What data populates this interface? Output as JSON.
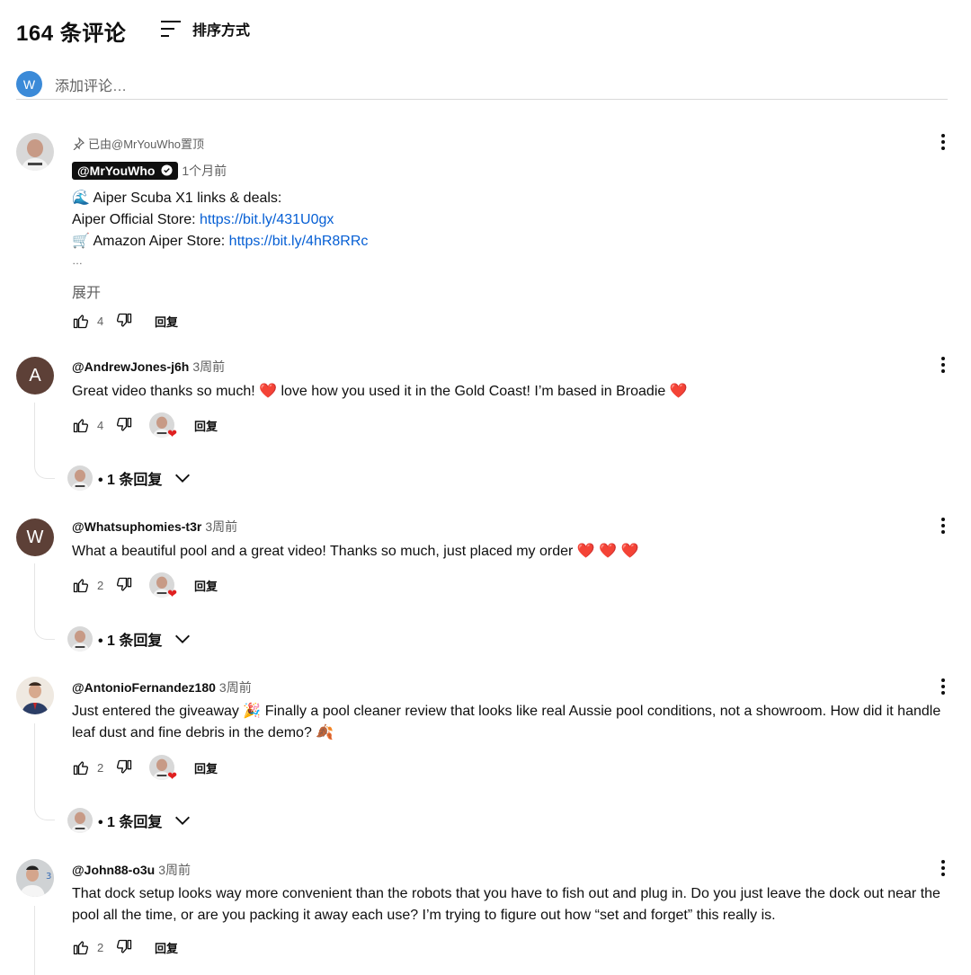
{
  "header": {
    "count_title": "164 条评论",
    "sort_label": "排序方式"
  },
  "add_comment": {
    "avatar_letter": "W",
    "placeholder": "添加评论…"
  },
  "comments": [
    {
      "pinned_label": "已由@MrYouWho置顶",
      "author": "@MrYouWho",
      "time": "1个月前",
      "lines": [
        {
          "emoji": "🌊",
          "text": "Aiper Scuba X1 links & deals:",
          "link": ""
        },
        {
          "emoji": "",
          "text": "Aiper Official Store: ",
          "link": "https://bit.ly/431U0gx"
        },
        {
          "emoji": "🛒",
          "text": "Amazon Aiper Store: ",
          "link": "https://bit.ly/4hR8RRc"
        }
      ],
      "ellipsis": "…",
      "expand": "展开",
      "likes": "4",
      "reply": "回复"
    },
    {
      "avatar_letter": "A",
      "author": "@AndrewJones-j6h",
      "time": "3周前",
      "text": "Great video thanks so much! ❤️ love how you used it in the Gold Coast! I’m based in Broadie ❤️",
      "likes": "4",
      "reply": "回复",
      "replies": "• 1 条回复"
    },
    {
      "avatar_letter": "W",
      "author": "@Whatsuphomies-t3r",
      "time": "3周前",
      "text": "What a beautiful pool and a great video! Thanks so much, just placed my order ❤️ ❤️ ❤️",
      "likes": "2",
      "reply": "回复",
      "replies": "• 1 条回复"
    },
    {
      "author": "@AntonioFernandez180",
      "time": "3周前",
      "text": "Just entered the giveaway 🎉 Finally a pool cleaner review that looks like real Aussie pool conditions, not a showroom. How did it handle leaf dust and fine debris in the demo? 🍂",
      "likes": "2",
      "reply": "回复",
      "replies": "• 1 条回复"
    },
    {
      "author": "@John88-o3u",
      "time": "3周前",
      "text": "That dock setup looks way more convenient than the robots that you have to fish out and plug in. Do you just leave the dock out near the pool all the time, or are you packing it away each use? I’m trying to figure out how “set and forget” this really is.",
      "likes": "2",
      "reply": "回复"
    }
  ]
}
